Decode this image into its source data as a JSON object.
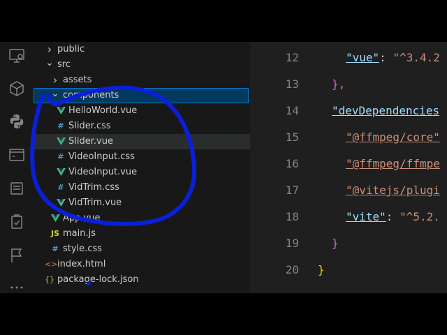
{
  "explorer": {
    "items": [
      {
        "label": "public",
        "icon": "chevron-right-icon"
      },
      {
        "label": "src",
        "icon": "chevron-down-icon"
      },
      {
        "label": "assets",
        "icon": "chevron-right-icon"
      },
      {
        "label": "components",
        "icon": "chevron-down-icon"
      },
      {
        "label": "HelloWorld.vue",
        "icon": "vue-file-icon"
      },
      {
        "label": "Slider.css",
        "icon": "css-file-icon"
      },
      {
        "label": "Slider.vue",
        "icon": "vue-file-icon"
      },
      {
        "label": "VideoInput.css",
        "icon": "css-file-icon"
      },
      {
        "label": "VideoInput.vue",
        "icon": "vue-file-icon"
      },
      {
        "label": "VidTrim.css",
        "icon": "css-file-icon"
      },
      {
        "label": "VidTrim.vue",
        "icon": "vue-file-icon"
      },
      {
        "label": "App.vue",
        "icon": "vue-file-icon"
      },
      {
        "label": "main.js",
        "icon": "js-file-icon"
      },
      {
        "label": "style.css",
        "icon": "css-file-icon"
      },
      {
        "label": "index.html",
        "icon": "html-file-icon"
      },
      {
        "label": "package-lock.json",
        "icon": "json-file-icon"
      }
    ],
    "selected": "components",
    "hovered": "Slider.vue"
  },
  "icon_glyphs": {
    "chevron_right": "›",
    "chevron_down": "⌄",
    "css": "#",
    "js": "JS",
    "html": "<>",
    "json": "{}"
  },
  "editor": {
    "lines": [
      {
        "number": "12",
        "key": "\"vue\"",
        "sep": ": ",
        "value": "\"^3.4.2"
      },
      {
        "number": "13",
        "text": "},"
      },
      {
        "number": "14",
        "key": "\"devDependencies"
      },
      {
        "number": "15",
        "value": "\"@ffmpeg/core\""
      },
      {
        "number": "16",
        "value": "\"@ffmpeg/ffmpe"
      },
      {
        "number": "17",
        "value": "\"@vitejs/plugi"
      },
      {
        "number": "18",
        "key": "\"vite\"",
        "sep": ": ",
        "value": "\"^5.2."
      },
      {
        "number": "19",
        "text": "}"
      },
      {
        "number": "20",
        "text": "}"
      }
    ]
  },
  "colors": {
    "annotation": "#0a1fd8",
    "selection": "#04395e",
    "vue_green": "#41b883"
  }
}
